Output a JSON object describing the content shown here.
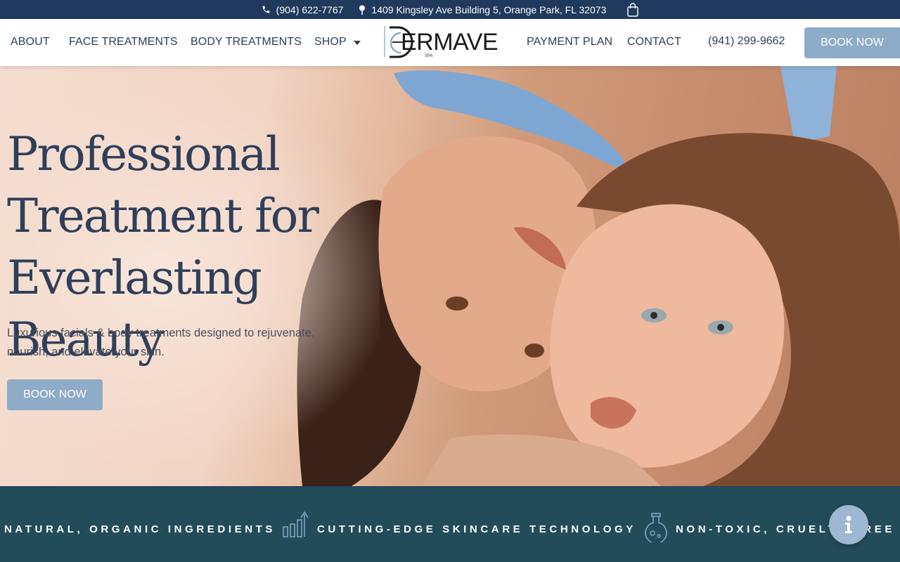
{
  "topbar": {
    "phone": "(904) 622-7767",
    "address": "1409 Kingsley Ave Building 5, Orange Park, FL 32073",
    "phone_icon": "phone-icon",
    "location_icon": "map-pin-icon",
    "cart_icon": "shopping-bag-icon"
  },
  "nav": {
    "about": "ABOUT",
    "face": "FACE TREATMENTS",
    "body": "BODY TREATMENTS",
    "shop": "SHOP",
    "payment": "PAYMENT PLAN",
    "contact": "CONTACT",
    "phone": "(941) 299-9662",
    "book": "BOOK NOW"
  },
  "logo": {
    "word": "ERMAVE",
    "sub": "SPA"
  },
  "hero": {
    "title": "Professional Treatment for Everlasting Beauty",
    "lead": "Luxurious facials & body treatments designed to rejuvenate, nourish, and elevate your skin.",
    "cta": "BOOK NOW"
  },
  "strip": {
    "items": [
      "NATURAL, ORGANIC INGREDIENTS",
      "CUTTING-EDGE SKINCARE TECHNOLOGY",
      "NON-TOXIC, CRUELTY-FREE FO"
    ]
  },
  "colors": {
    "topbar": "#1f3a5c",
    "accent": "#8eabc7",
    "heading": "#2f3f5a",
    "strip": "#234c5a"
  }
}
